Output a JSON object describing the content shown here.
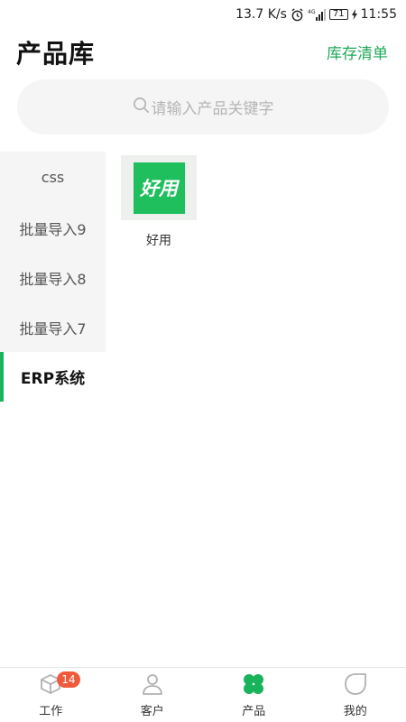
{
  "status_bar": {
    "speed": "13.7 K/s",
    "network": "4G",
    "battery": "71",
    "time": "11:55"
  },
  "header": {
    "title": "产品库",
    "inventory_link": "库存清单"
  },
  "search": {
    "placeholder": "请输入产品关键字"
  },
  "categories": [
    {
      "label": "css"
    },
    {
      "label": "批量导入9"
    },
    {
      "label": "批量导入8"
    },
    {
      "label": "批量导入7"
    },
    {
      "label": "ERP系统",
      "active": true
    }
  ],
  "products": [
    {
      "name": "好用",
      "logo_text": "好用"
    }
  ],
  "tabs": [
    {
      "label": "工作",
      "badge": "14",
      "icon": "box-icon"
    },
    {
      "label": "客户",
      "icon": "person-icon"
    },
    {
      "label": "产品",
      "icon": "clover-icon",
      "active": true
    },
    {
      "label": "我的",
      "icon": "leaf-icon"
    }
  ],
  "colors": {
    "accent": "#1faa59",
    "active_icon": "#18b35a",
    "badge": "#f05a3c",
    "logo": "#1fbf5e"
  }
}
